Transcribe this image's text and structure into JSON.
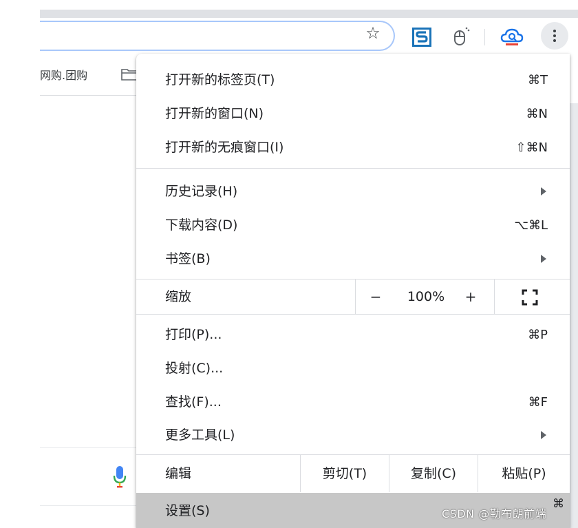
{
  "toolbar": {
    "star_icon": "star-icon",
    "extensions": [
      "s-extension-icon",
      "mouse-extension-icon",
      "cloud-extension-icon"
    ],
    "menu_icon": "three-dots-vertical-icon"
  },
  "bookmarks": {
    "visible_text": "网购.团购",
    "folder_icon": "folder-icon"
  },
  "menu": {
    "new_tab": {
      "label": "打开新的标签页(T)",
      "shortcut": "⌘T"
    },
    "new_window": {
      "label": "打开新的窗口(N)",
      "shortcut": "⌘N"
    },
    "incognito": {
      "label": "打开新的无痕窗口(I)",
      "shortcut": "⇧⌘N"
    },
    "history": {
      "label": "历史记录(H)"
    },
    "downloads": {
      "label": "下载内容(D)",
      "shortcut": "⌥⌘L"
    },
    "bookmarks": {
      "label": "书签(B)"
    },
    "zoom": {
      "label": "缩放",
      "minus": "−",
      "value": "100%",
      "plus": "+"
    },
    "print": {
      "label": "打印(P)...",
      "shortcut": "⌘P"
    },
    "cast": {
      "label": "投射(C)..."
    },
    "find": {
      "label": "查找(F)...",
      "shortcut": "⌘F"
    },
    "more_tools": {
      "label": "更多工具(L)"
    },
    "edit": {
      "label": "编辑",
      "cut": "剪切(T)",
      "copy": "复制(C)",
      "paste": "粘贴(P)"
    },
    "settings": {
      "label": "设置(S)",
      "shortcut": "⌘"
    }
  },
  "watermark": "CSDN @勒布朗前端",
  "colors": {
    "accent": "#a8c7fa",
    "hover": "#c7c7c7",
    "separator": "#dadce0"
  }
}
